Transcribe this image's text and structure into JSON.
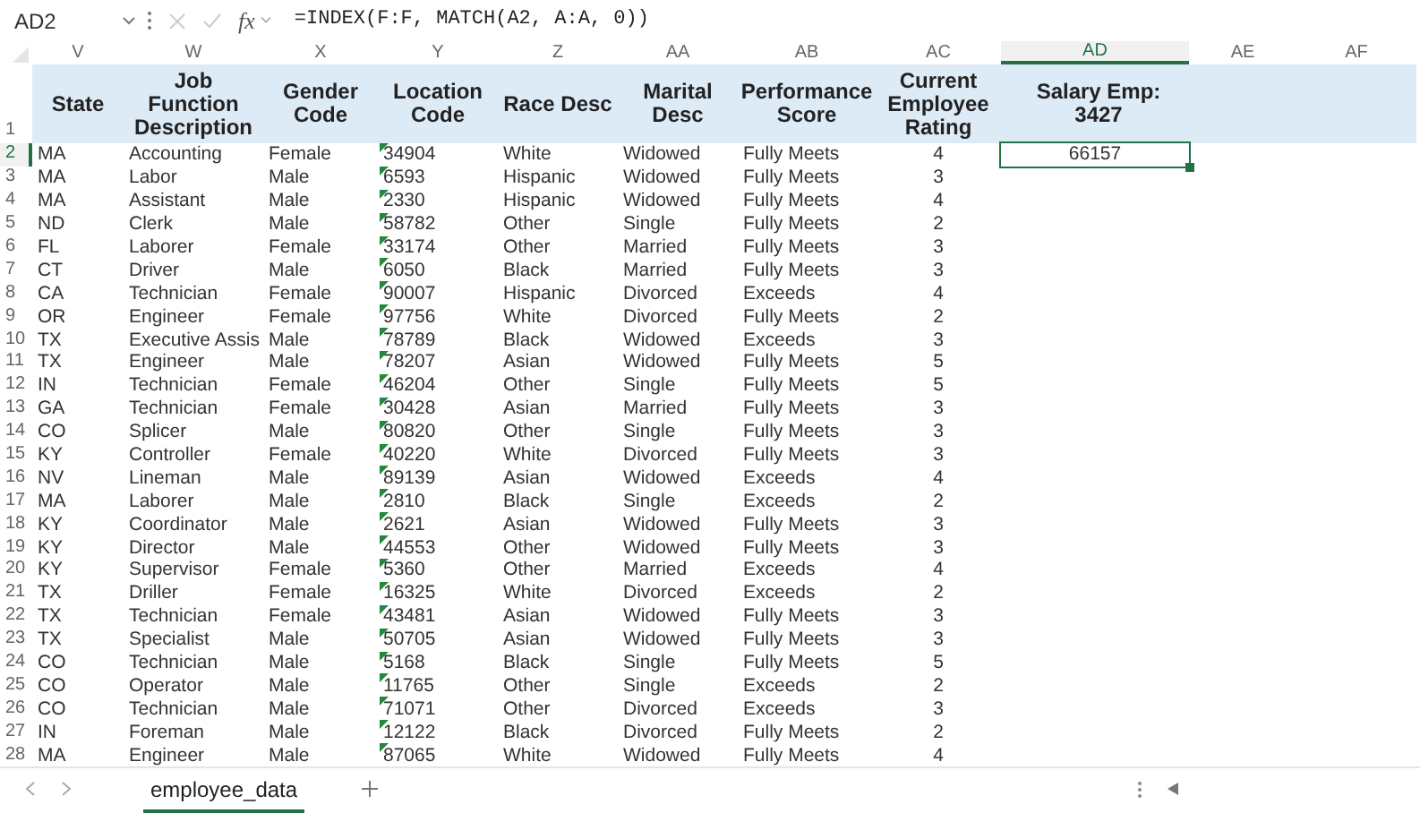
{
  "formula_bar": {
    "name_box": "AD2",
    "function_label": "fx",
    "formula": "=INDEX(F:F, MATCH(A2, A:A, 0))"
  },
  "columns": [
    {
      "letter": "V",
      "selected": false
    },
    {
      "letter": "W",
      "selected": false
    },
    {
      "letter": "X",
      "selected": false
    },
    {
      "letter": "Y",
      "selected": false,
      "number_stored_as_text": true
    },
    {
      "letter": "Z",
      "selected": false
    },
    {
      "letter": "AA",
      "selected": false
    },
    {
      "letter": "AB",
      "selected": false
    },
    {
      "letter": "AC",
      "selected": false
    },
    {
      "letter": "AD",
      "selected": true
    },
    {
      "letter": "AE",
      "selected": false
    },
    {
      "letter": "AF",
      "selected": false
    }
  ],
  "header_row": {
    "number": "1",
    "cells": [
      "State",
      "Job Function Description",
      "Gender Code",
      "Location Code",
      "Race Desc",
      "Marital Desc",
      "Performance Score",
      "Current Employee Rating",
      "Salary Emp: 3427"
    ]
  },
  "rows": [
    {
      "number": "2",
      "selected": true,
      "cells": [
        "MA",
        "Accounting",
        "Female",
        "34904",
        "White",
        "Widowed",
        "Fully Meets",
        "4",
        "66157"
      ]
    },
    {
      "number": "3",
      "selected": false,
      "cells": [
        "MA",
        "Labor",
        "Male",
        "6593",
        "Hispanic",
        "Widowed",
        "Fully Meets",
        "3"
      ]
    },
    {
      "number": "4",
      "selected": false,
      "cells": [
        "MA",
        "Assistant",
        "Male",
        "2330",
        "Hispanic",
        "Widowed",
        "Fully Meets",
        "4"
      ]
    },
    {
      "number": "5",
      "selected": false,
      "cells": [
        "ND",
        "Clerk",
        "Male",
        "58782",
        "Other",
        "Single",
        "Fully Meets",
        "2"
      ]
    },
    {
      "number": "6",
      "selected": false,
      "cells": [
        "FL",
        "Laborer",
        "Female",
        "33174",
        "Other",
        "Married",
        "Fully Meets",
        "3"
      ]
    },
    {
      "number": "7",
      "selected": false,
      "cells": [
        "CT",
        "Driver",
        "Male",
        "6050",
        "Black",
        "Married",
        "Fully Meets",
        "3"
      ]
    },
    {
      "number": "8",
      "selected": false,
      "cells": [
        "CA",
        "Technician",
        "Female",
        "90007",
        "Hispanic",
        "Divorced",
        "Exceeds",
        "4"
      ]
    },
    {
      "number": "9",
      "selected": false,
      "cells": [
        "OR",
        "Engineer",
        "Female",
        "97756",
        "White",
        "Divorced",
        "Fully Meets",
        "2"
      ]
    },
    {
      "number": "10",
      "selected": false,
      "cells": [
        "TX",
        "Executive Assis",
        "Male",
        "78789",
        "Black",
        "Widowed",
        "Exceeds",
        "3"
      ]
    },
    {
      "number": "11",
      "selected": false,
      "cells": [
        "TX",
        "Engineer",
        "Male",
        "78207",
        "Asian",
        "Widowed",
        "Fully Meets",
        "5"
      ]
    },
    {
      "number": "12",
      "selected": false,
      "cells": [
        "IN",
        "Technician",
        "Female",
        "46204",
        "Other",
        "Single",
        "Fully Meets",
        "5"
      ]
    },
    {
      "number": "13",
      "selected": false,
      "cells": [
        "GA",
        "Technician",
        "Female",
        "30428",
        "Asian",
        "Married",
        "Fully Meets",
        "3"
      ]
    },
    {
      "number": "14",
      "selected": false,
      "cells": [
        "CO",
        "Splicer",
        "Male",
        "80820",
        "Other",
        "Single",
        "Fully Meets",
        "3"
      ]
    },
    {
      "number": "15",
      "selected": false,
      "cells": [
        "KY",
        "Controller",
        "Female",
        "40220",
        "White",
        "Divorced",
        "Fully Meets",
        "3"
      ]
    },
    {
      "number": "16",
      "selected": false,
      "cells": [
        "NV",
        "Lineman",
        "Male",
        "89139",
        "Asian",
        "Widowed",
        "Exceeds",
        "4"
      ]
    },
    {
      "number": "17",
      "selected": false,
      "cells": [
        "MA",
        "Laborer",
        "Male",
        "2810",
        "Black",
        "Single",
        "Exceeds",
        "2"
      ]
    },
    {
      "number": "18",
      "selected": false,
      "cells": [
        "KY",
        "Coordinator",
        "Male",
        "2621",
        "Asian",
        "Widowed",
        "Fully Meets",
        "3"
      ]
    },
    {
      "number": "19",
      "selected": false,
      "cells": [
        "KY",
        "Director",
        "Male",
        "44553",
        "Other",
        "Widowed",
        "Fully Meets",
        "3"
      ]
    },
    {
      "number": "20",
      "selected": false,
      "cells": [
        "KY",
        "Supervisor",
        "Female",
        "5360",
        "Other",
        "Married",
        "Exceeds",
        "4"
      ]
    },
    {
      "number": "21",
      "selected": false,
      "cells": [
        "TX",
        "Driller",
        "Female",
        "16325",
        "White",
        "Divorced",
        "Exceeds",
        "2"
      ]
    },
    {
      "number": "22",
      "selected": false,
      "cells": [
        "TX",
        "Technician",
        "Female",
        "43481",
        "Asian",
        "Widowed",
        "Fully Meets",
        "3"
      ]
    },
    {
      "number": "23",
      "selected": false,
      "cells": [
        "TX",
        "Specialist",
        "Male",
        "50705",
        "Asian",
        "Widowed",
        "Fully Meets",
        "3"
      ]
    },
    {
      "number": "24",
      "selected": false,
      "cells": [
        "CO",
        "Technician",
        "Male",
        "5168",
        "Black",
        "Single",
        "Fully Meets",
        "5"
      ]
    },
    {
      "number": "25",
      "selected": false,
      "cells": [
        "CO",
        "Operator",
        "Male",
        "11765",
        "Other",
        "Single",
        "Exceeds",
        "2"
      ]
    },
    {
      "number": "26",
      "selected": false,
      "cells": [
        "CO",
        "Technician",
        "Male",
        "71071",
        "Other",
        "Divorced",
        "Exceeds",
        "3"
      ]
    },
    {
      "number": "27",
      "selected": false,
      "cells": [
        "IN",
        "Foreman",
        "Male",
        "12122",
        "Black",
        "Divorced",
        "Fully Meets",
        "2"
      ]
    },
    {
      "number": "28",
      "selected": false,
      "cells": [
        "MA",
        "Engineer",
        "Male",
        "87065",
        "White",
        "Widowed",
        "Fully Meets",
        "4"
      ]
    }
  ],
  "sheet_tabs": [
    {
      "label": "employee_data",
      "selected": true
    }
  ]
}
